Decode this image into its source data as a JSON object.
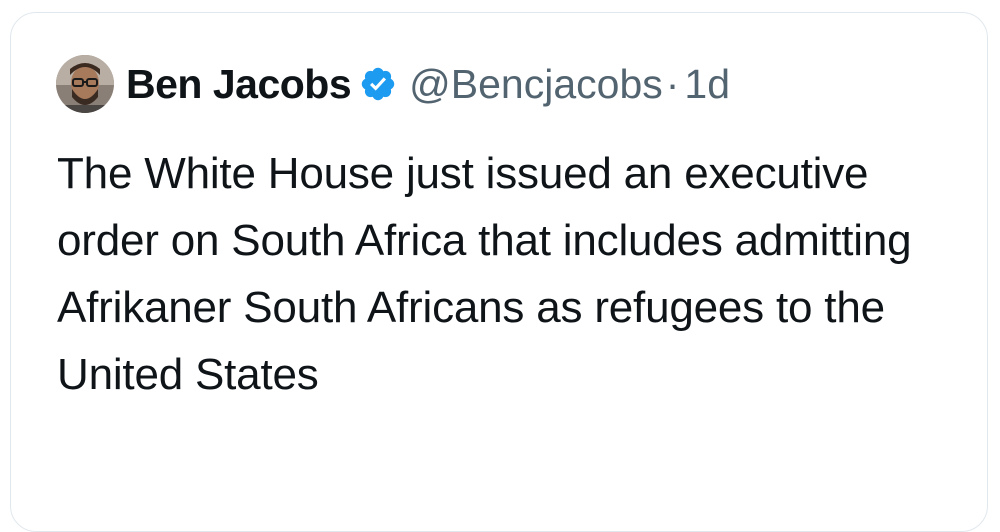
{
  "tweet": {
    "author_name": "Ben Jacobs",
    "handle": "@Bencjacobs",
    "separator": "·",
    "timestamp": "1d",
    "verified": true,
    "text": "The White House just issued an executive order on South Africa that includes admitting Afrikaner South Africans as refugees to the United States"
  },
  "icons": {
    "avatar": "avatar",
    "verified": "verified-badge-icon"
  },
  "colors": {
    "verified_blue": "#1d9bf0",
    "text_primary": "#0f1419",
    "text_secondary": "#536471",
    "border": "#e1e8ed"
  }
}
